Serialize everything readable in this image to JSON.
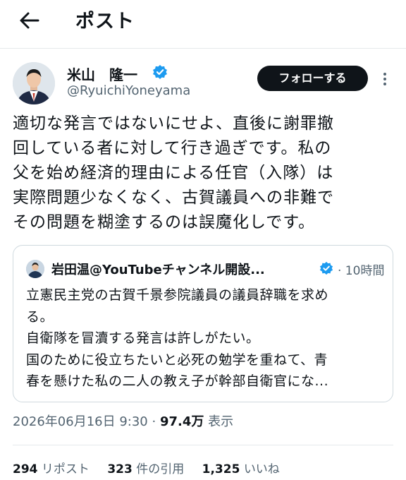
{
  "header": {
    "title": "ポスト"
  },
  "author": {
    "name": "米山　隆一",
    "handle": "@RyuichiYoneyama"
  },
  "follow_label": "フォローする",
  "tweet": {
    "lines": [
      "適切な発言ではないにせよ、直後に謝罪撤",
      "回している者に対して行き過ぎです。私の",
      "父を始め経済的理由による任官（入隊）は",
      "実際問題少なくなく、古賀議員への非難で",
      "その問題を糊塗するのは誤魔化しです。"
    ]
  },
  "quote": {
    "name": "岩田温@YouTubeチャンネル開設...",
    "time": "· 10時間",
    "lines": [
      "立憲民主党の古賀千景参院議員の議員辞職を求め",
      "る。",
      "自衛隊を冒瀆する発言は許しがたい。",
      "国のために役立ちたいと必死の勉学を重ねて、青",
      "春を懸けた私の二人の教え子が幹部自衛官にな..."
    ]
  },
  "meta": {
    "datetime": "2026年06月16日 9:30",
    "views": "97.4万",
    "views_label": "表示"
  },
  "stats": {
    "reposts": "294",
    "reposts_label": "リポスト",
    "quotes": "323",
    "quotes_label": "件の引用",
    "likes": "1,325",
    "likes_label": "いいね"
  },
  "colors": {
    "accent": "#1d9bf0",
    "text": "#0f1419",
    "secondary": "#536471",
    "border": "#cfd9de"
  },
  "icons": {
    "back": "arrow-left-icon",
    "verified": "verified-badge-icon",
    "more": "more-vertical-icon"
  }
}
